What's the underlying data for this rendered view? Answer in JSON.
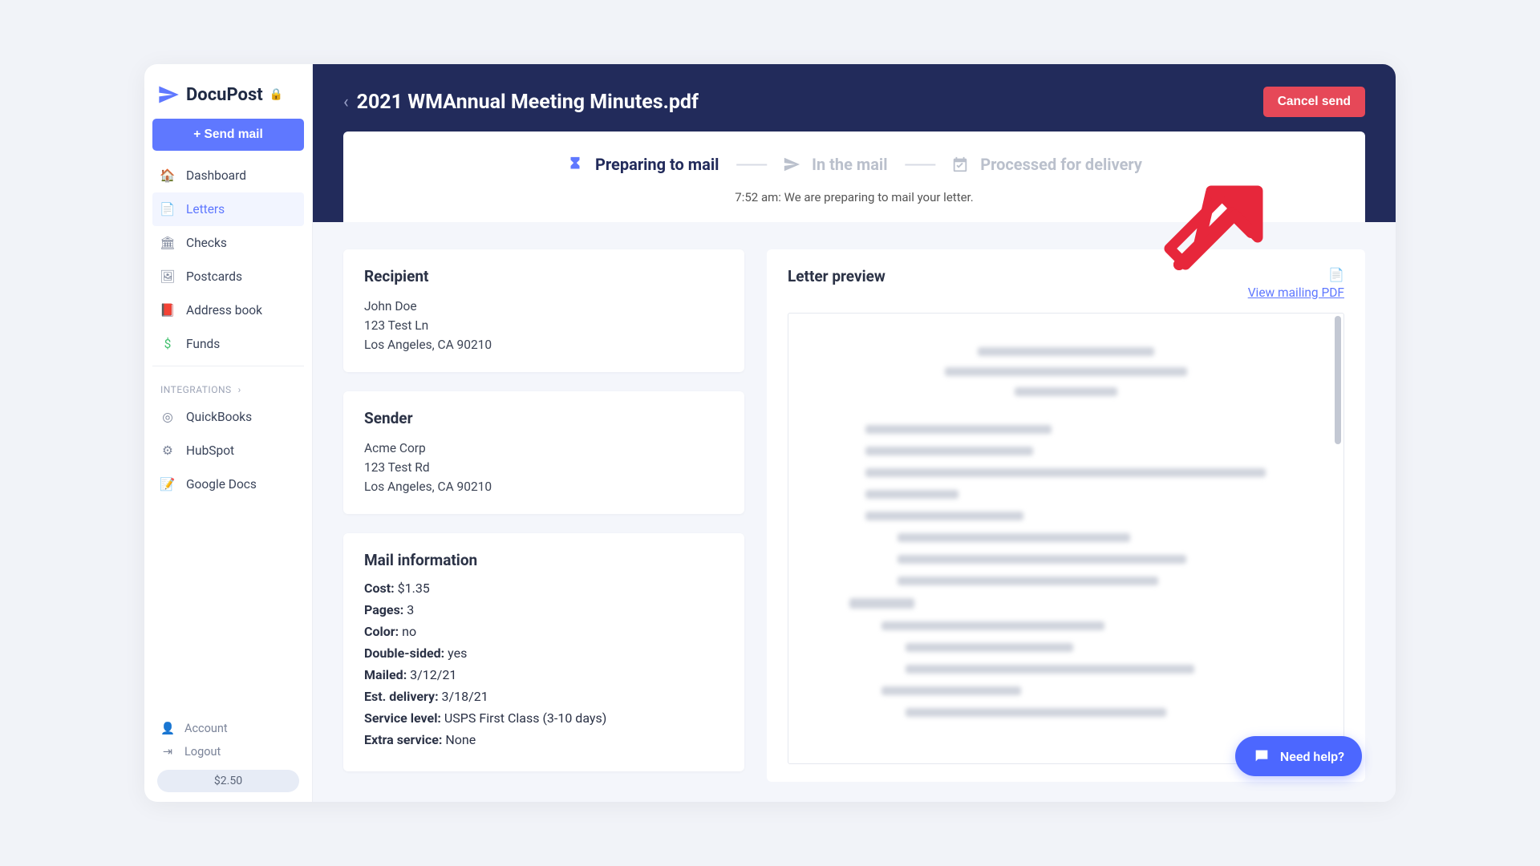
{
  "brand": {
    "name": "DocuPost"
  },
  "sidebar": {
    "send_mail_label": "+ Send mail",
    "items": [
      {
        "label": "Dashboard"
      },
      {
        "label": "Letters"
      },
      {
        "label": "Checks"
      },
      {
        "label": "Postcards"
      },
      {
        "label": "Address book"
      },
      {
        "label": "Funds"
      }
    ],
    "integrations_label": "INTEGRATIONS",
    "integrations": [
      {
        "label": "QuickBooks"
      },
      {
        "label": "HubSpot"
      },
      {
        "label": "Google Docs"
      }
    ],
    "account_label": "Account",
    "logout_label": "Logout",
    "balance": "$2.50"
  },
  "header": {
    "title": "2021 WMAnnual Meeting Minutes.pdf",
    "cancel_label": "Cancel send"
  },
  "status": {
    "steps": [
      {
        "label": "Preparing to mail"
      },
      {
        "label": "In the mail"
      },
      {
        "label": "Processed for delivery"
      }
    ],
    "message": "7:52 am: We are preparing to mail your letter."
  },
  "recipient": {
    "title": "Recipient",
    "name": "John Doe",
    "line1": "123 Test Ln",
    "line2": "Los Angeles, CA 90210"
  },
  "sender": {
    "title": "Sender",
    "name": "Acme Corp",
    "line1": "123 Test Rd",
    "line2": "Los Angeles, CA 90210"
  },
  "mailinfo": {
    "title": "Mail information",
    "labels": {
      "cost": "Cost:",
      "pages": "Pages:",
      "color": "Color:",
      "double_sided": "Double-sided:",
      "mailed": "Mailed:",
      "est_delivery": "Est. delivery:",
      "service_level": "Service level:",
      "extra_service": "Extra service:"
    },
    "values": {
      "cost": "$1.35",
      "pages": "3",
      "color": "no",
      "double_sided": "yes",
      "mailed": "3/12/21",
      "est_delivery": "3/18/21",
      "service_level": "USPS First Class (3-10 days)",
      "extra_service": "None"
    }
  },
  "preview": {
    "title": "Letter preview",
    "view_pdf_label": "View mailing PDF"
  },
  "help": {
    "label": "Need help?"
  }
}
